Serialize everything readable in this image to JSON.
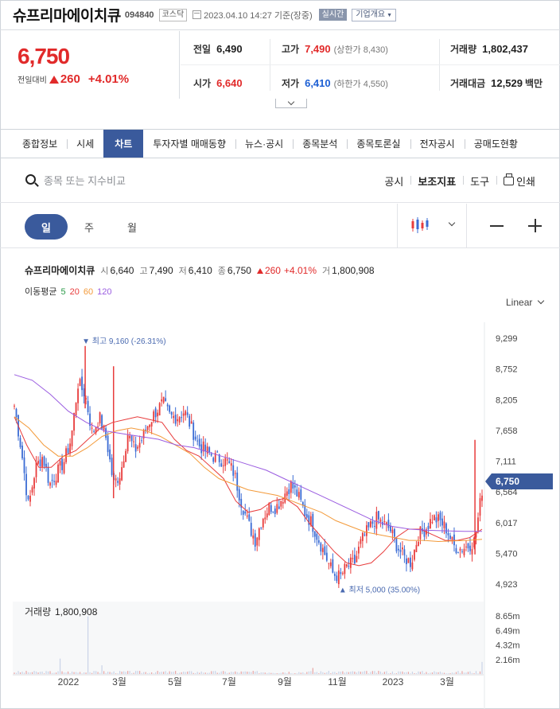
{
  "header": {
    "name": "슈프리마에이치큐",
    "code": "094840",
    "market": "코스닥",
    "datetime": "2023.04.10 14:27 기준(장중)",
    "realtime": "실시간",
    "company_btn": "기업개요"
  },
  "price": {
    "current": "6,750",
    "change_label": "전일대비",
    "change_value": "260",
    "change_pct": "+4.01%"
  },
  "stats": {
    "prev": {
      "label": "전일",
      "value": "6,490"
    },
    "high": {
      "label": "고가",
      "value": "7,490",
      "sub": "(상한가 8,430)"
    },
    "volume": {
      "label": "거래량",
      "value": "1,802,437"
    },
    "open": {
      "label": "시가",
      "value": "6,640"
    },
    "low": {
      "label": "저가",
      "value": "6,410",
      "sub": "(하한가 4,550)"
    },
    "amount": {
      "label": "거래대금",
      "value": "12,529",
      "unit": "백만"
    }
  },
  "tabs": [
    "종합정보",
    "시세",
    "차트",
    "투자자별 매매동향",
    "뉴스·공시",
    "종목분석",
    "종목토론실",
    "전자공시",
    "공매도현황"
  ],
  "active_tab": "차트",
  "toolbar": {
    "search_placeholder": "종목 또는 지수비교",
    "links": [
      "공시",
      "보조지표",
      "도구"
    ],
    "print": "인쇄"
  },
  "periods": [
    "일",
    "주",
    "월"
  ],
  "active_period": "일",
  "info": {
    "name": "슈프리마에이치큐",
    "open_label": "시",
    "open": "6,640",
    "high_label": "고",
    "high": "7,490",
    "low_label": "저",
    "low": "6,410",
    "close_label": "종",
    "close": "6,750",
    "change": "260",
    "pct": "+4.01%",
    "vol_label": "거",
    "vol": "1,800,908"
  },
  "ma": {
    "label": "이동평균",
    "periods": [
      {
        "label": "5",
        "color": "#2a9a48"
      },
      {
        "label": "20",
        "color": "#e83c3c"
      },
      {
        "label": "60",
        "color": "#f39a3a"
      },
      {
        "label": "120",
        "color": "#9a5ce0"
      }
    ]
  },
  "scale_mode": "Linear",
  "chart_data": {
    "type": "candlestick",
    "y_ticks": [
      "9,299",
      "8,752",
      "8,205",
      "7,658",
      "7,111",
      "6,564",
      "6,017",
      "5,470",
      "4,923"
    ],
    "y_range": [
      4923,
      9299
    ],
    "x_ticks": [
      "2022",
      "3월",
      "5월",
      "7월",
      "9월",
      "11월",
      "2023",
      "3월"
    ],
    "current_label": "6,750",
    "current_value": 6750,
    "max_annotation": "최고 9,160 (-26.31%)",
    "max_value": 9160,
    "min_annotation": "최저 5,000 (35.00%)",
    "min_value": 5000,
    "close_path": [
      8100,
      7300,
      6300,
      7000,
      7200,
      6700,
      6900,
      7100,
      7500,
      8500,
      8300,
      7600,
      7900,
      7500,
      6700,
      6900,
      7600,
      7300,
      7500,
      7800,
      8000,
      8150,
      7900,
      7900,
      8000,
      7700,
      7400,
      7300,
      7200,
      7150,
      7100,
      6900,
      6400,
      6000,
      5700,
      6100,
      6300,
      6300,
      6500,
      6700,
      6500,
      6200,
      6000,
      5700,
      5400,
      5100,
      5050,
      5250,
      5300,
      5700,
      5900,
      6100,
      6000,
      5900,
      5600,
      5400,
      5300,
      5800,
      5900,
      6100,
      6050,
      5900,
      5600,
      5550,
      5600,
      5700,
      6600
    ],
    "spikes": [
      {
        "i": 10,
        "hi": 9160
      },
      {
        "i": 14,
        "hi": 8800
      },
      {
        "i": 65,
        "hi": 7490
      }
    ],
    "ma_series": {
      "ma20": [
        7900,
        7400,
        7000,
        7000,
        7200,
        7300,
        7500,
        7700,
        7800,
        7850,
        7900,
        7850,
        7800,
        7500,
        7300,
        7200,
        7000,
        6800,
        6400,
        6200,
        6250,
        6400,
        6450,
        6300,
        6000,
        5750,
        5500,
        5300,
        5250,
        5300,
        5500,
        5750,
        5900,
        5900,
        5800,
        5700,
        5700,
        5750,
        5900
      ],
      "ma60": [
        7900,
        7700,
        7400,
        7200,
        7200,
        7350,
        7550,
        7650,
        7700,
        7650,
        7550,
        7400,
        7250,
        7000,
        6800,
        6700,
        6600,
        6550,
        6500,
        6400,
        6300,
        6200,
        6050,
        5950,
        5850,
        5800,
        5750,
        5700,
        5700,
        5680,
        5690,
        5700,
        5720
      ],
      "ma120": [
        8650,
        8550,
        8300,
        8000,
        7800,
        7650,
        7600,
        7550,
        7500,
        7400,
        7350,
        7250,
        7150,
        7050,
        6950,
        6800,
        6650,
        6500,
        6350,
        6200,
        6050,
        5950,
        5900,
        5880,
        5870,
        5860,
        5860
      ]
    },
    "volume": {
      "label": "거래량",
      "value": "1,800,908",
      "y_ticks": [
        "8.65m",
        "6.49m",
        "4.32m",
        "2.16m"
      ],
      "y_range": [
        0,
        10800000
      ]
    }
  }
}
